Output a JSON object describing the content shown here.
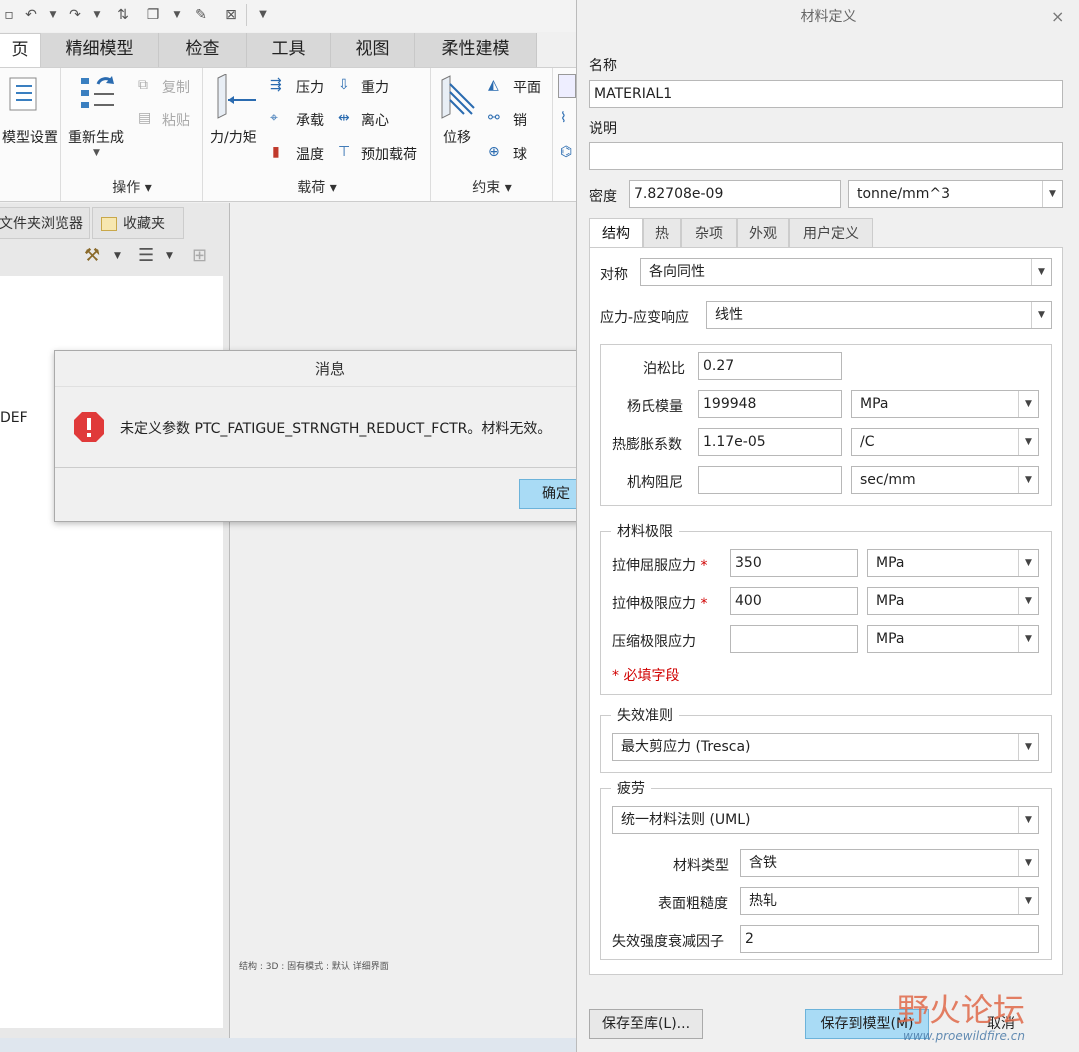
{
  "ribbon": {
    "tabs": [
      "页",
      "精细模型",
      "检查",
      "工具",
      "视图",
      "柔性建模"
    ],
    "buttons": {
      "model_setup": "模型设置",
      "regenerate": "重新生成",
      "copy": "复制",
      "paste": "粘贴",
      "force_moment": "力/力矩",
      "pressure": "压力",
      "gravity": "重力",
      "bearing": "承载",
      "centrifugal": "离心",
      "temperature": "温度",
      "preload": "预加载荷",
      "displacement": "位移",
      "planar": "平面",
      "pin": "销",
      "ball": "球"
    },
    "groups": {
      "operations": "操作",
      "loads": "载荷",
      "constraints": "约束"
    }
  },
  "left_pane": {
    "tabs": [
      "文件夹浏览器",
      "收藏夹"
    ],
    "tree_item": "DEF"
  },
  "canvas": {
    "status_text": "结构 : 3D : 固有模式 : 默认 详细界面"
  },
  "message_dialog": {
    "title": "消息",
    "text": "未定义参数 PTC_FATIGUE_STRNGTH_REDUCT_FCTR。材料无效。",
    "ok_label": "确定",
    "icon": "error-icon"
  },
  "material_dialog": {
    "title": "材料定义",
    "name_label": "名称",
    "name_value": "MATERIAL1",
    "desc_label": "说明",
    "desc_value": "",
    "density_label": "密度",
    "density_value": "7.82708e-09",
    "density_unit": "tonne/mm^3",
    "tabs": [
      "结构",
      "热",
      "杂项",
      "外观",
      "用户定义"
    ],
    "symmetry_label": "对称",
    "symmetry_value": "各向同性",
    "stress_strain_label": "应力-应变响应",
    "stress_strain_value": "线性",
    "poisson_label": "泊松比",
    "poisson_value": "0.27",
    "young_label": "杨氏模量",
    "young_value": "199948",
    "young_unit": "MPa",
    "cte_label": "热膨胀系数",
    "cte_value": "1.17e-05",
    "cte_unit": "/C",
    "damping_label": "机构阻尼",
    "damping_value": "",
    "damping_unit": "sec/mm",
    "limits_legend": "材料极限",
    "tensile_yield_label": "拉伸屈服应力",
    "tensile_yield_value": "350",
    "tensile_yield_unit": "MPa",
    "tensile_ultimate_label": "拉伸极限应力",
    "tensile_ultimate_value": "400",
    "tensile_ultimate_unit": "MPa",
    "compressive_label": "压缩极限应力",
    "compressive_value": "",
    "compressive_unit": "MPa",
    "required_star": "*",
    "required_note": "* 必填字段",
    "failure_legend": "失效准则",
    "failure_value": "最大剪应力 (Tresca)",
    "fatigue_legend": "疲劳",
    "fatigue_value": "统一材料法则 (UML)",
    "material_type_label": "材料类型",
    "material_type_value": "含铁",
    "surface_label": "表面粗糙度",
    "surface_value": "热轧",
    "reduction_label": "失效强度衰减因子",
    "reduction_value": "2",
    "save_lib_label": "保存至库(L)...",
    "save_model_label": "保存到模型(M)",
    "cancel_label": "取消"
  },
  "watermark": {
    "text": "野火论坛",
    "url": "www.proewildfire.cn"
  },
  "colors": {
    "primary_button": "#a9dbf5",
    "error": "#e03a3a",
    "required": "#d00000"
  }
}
